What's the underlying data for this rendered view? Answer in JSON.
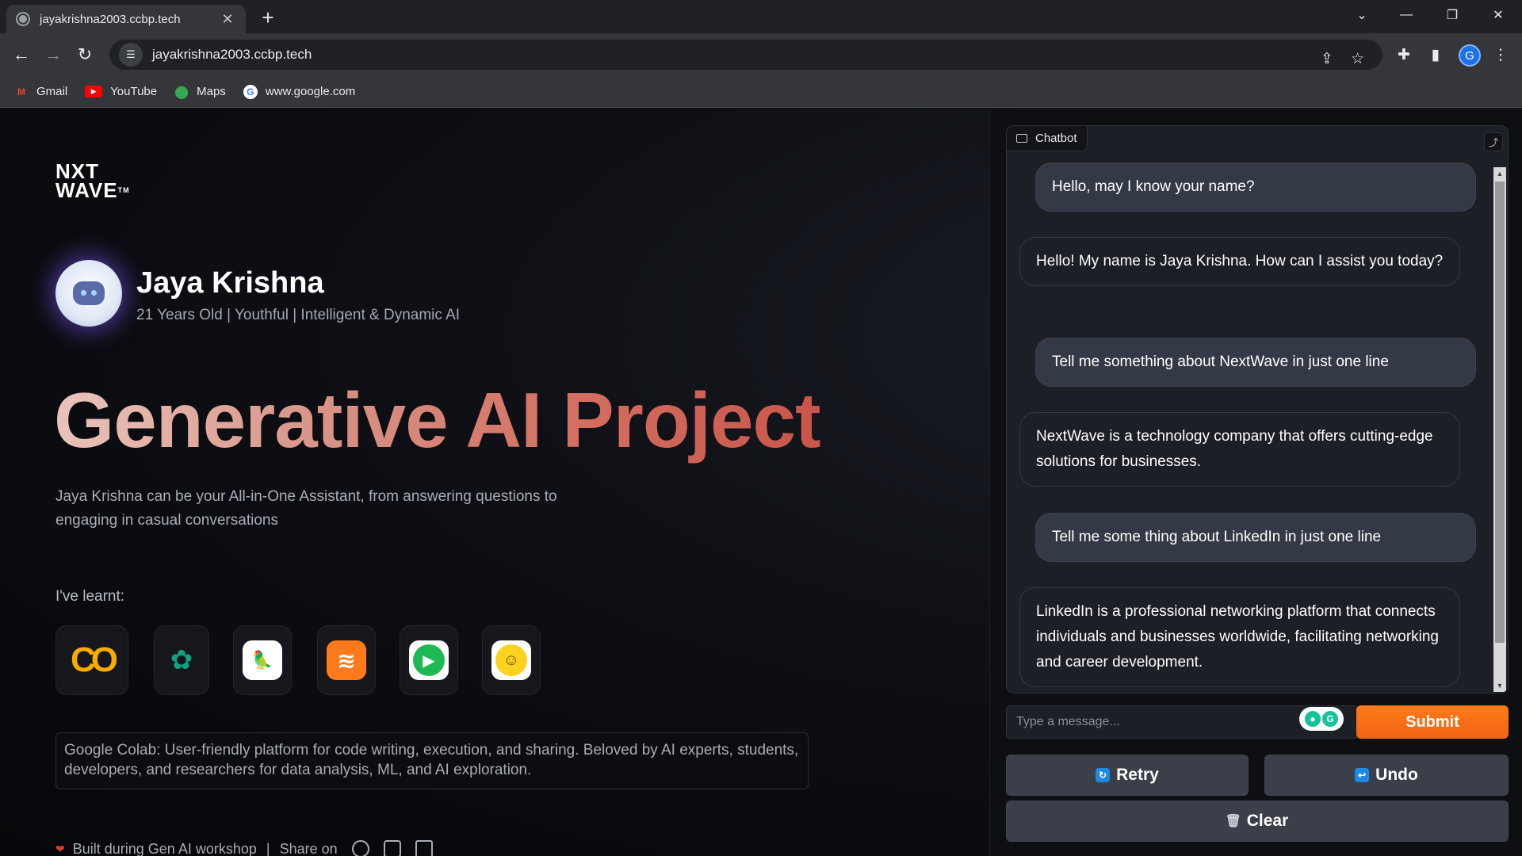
{
  "browser": {
    "tab_title": "jayakrishna2003.ccbp.tech",
    "tab_close": "✕",
    "new_tab": "+",
    "url": "jayakrishna2003.ccbp.tech",
    "profile_initial": "G",
    "bookmarks": [
      {
        "label": "Gmail",
        "icon": "gmail-icon"
      },
      {
        "label": "YouTube",
        "icon": "youtube-icon"
      },
      {
        "label": "Maps",
        "icon": "maps-icon"
      },
      {
        "label": "www.google.com",
        "icon": "google-icon"
      }
    ]
  },
  "profile": {
    "logo_line1": "NXT",
    "logo_line2": "WAVE",
    "logo_tm": "TM",
    "name": "Jaya Krishna",
    "tagline": "21 Years Old | Youthful | Intelligent & Dynamic AI"
  },
  "hero": {
    "title": "Generative AI Project",
    "description": "Jaya Krishna can be your All-in-One Assistant, from answering questions to engaging in casual conversations",
    "learnt_label": "I've learnt:",
    "tools": [
      {
        "name": "Google Colab",
        "icon": "colab-icon"
      },
      {
        "name": "ChatGPT",
        "icon": "openai-icon"
      },
      {
        "name": "LangChain",
        "icon": "langchain-icon"
      },
      {
        "name": "Stack",
        "icon": "stack-icon"
      },
      {
        "name": "Play",
        "icon": "play-icon"
      },
      {
        "name": "Hugging Face",
        "icon": "huggingface-icon"
      }
    ],
    "tool_description": "Google Colab: User-friendly platform for code writing, execution, and sharing. Beloved by AI experts, students, developers, and researchers for data analysis, ML, and AI exploration.",
    "footer_text": "Built during Gen AI workshop",
    "footer_share": "Share on"
  },
  "chat": {
    "label": "Chatbot",
    "messages": [
      {
        "role": "user",
        "text": "Hello, may I know your name?"
      },
      {
        "role": "bot",
        "text": "Hello! My name is Jaya Krishna. How can I assist you today?"
      },
      {
        "role": "user",
        "text": "Tell me something about NextWave in just one line"
      },
      {
        "role": "bot",
        "text": "NextWave is a technology company that offers cutting-edge solutions for businesses."
      },
      {
        "role": "user",
        "text": "Tell me some thing about LinkedIn in just one line"
      },
      {
        "role": "bot",
        "text": "LinkedIn is a professional networking platform that connects individuals and businesses worldwide, facilitating networking and career development."
      }
    ],
    "input_placeholder": "Type a message...",
    "submit_label": "Submit",
    "retry_label": "Retry",
    "undo_label": "Undo",
    "clear_label": "Clear"
  },
  "colors": {
    "accent_orange": "#f26412",
    "title_gradient_start": "#e9c4bb",
    "title_gradient_end": "#c9554a",
    "panel_bg": "#1c1f26"
  }
}
